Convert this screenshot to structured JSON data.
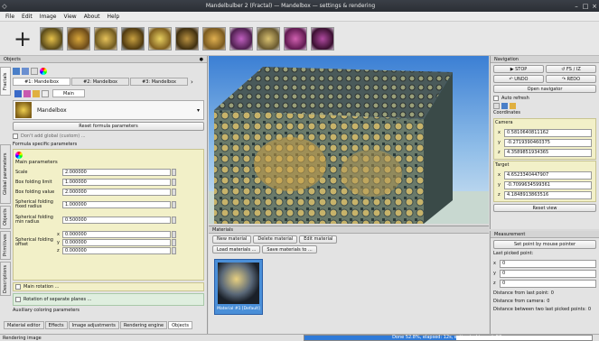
{
  "window": {
    "title": "Mandelbulber 2 (Fractal) — Mandelbox  — settings & rendering",
    "min": "–",
    "max": "□",
    "close": "×"
  },
  "menu": [
    "File",
    "Edit",
    "Image",
    "View",
    "About",
    "Help"
  ],
  "toolbar": {
    "add_icon": "+"
  },
  "objects_panel": {
    "title": "Objects",
    "tabs": [
      "Fractals",
      "Global parameters",
      "Objects",
      "Primitives",
      "Descriptions"
    ],
    "formula_tabs": [
      "#1: Mandelbox",
      "#2: Mandelbox",
      "#3: Mandelbox"
    ],
    "mini_tab": "Main",
    "formula_name": "Mandelbox",
    "reset_button": "Reset formula parameters",
    "check_label": "Don't add global (custom) ...",
    "section_label": "Formula specific parameters",
    "group_label": "Main parameters",
    "params": [
      {
        "label": "Scale",
        "value": "2.000000"
      },
      {
        "label": "Box folding limit",
        "value": "1.000000"
      },
      {
        "label": "Box folding value",
        "value": "2.000000"
      },
      {
        "label": "Spherical folding fixed radius",
        "value": "1.000000"
      },
      {
        "label": "Spherical folding min radius",
        "value": "0.500000"
      }
    ],
    "sph_offset_label": "Spherical folding offset",
    "sph_offset": {
      "x": "0.000000",
      "y": "0.000000",
      "z": "0.000000"
    },
    "main_rotation": "Main rotation ...",
    "rotation_sep": "Rotation of separate planes ...",
    "color_params": "Auxiliary coloring parameters",
    "bottom_tabs": [
      "Material editor",
      "Effects",
      "Image adjustments",
      "Rendering engine",
      "Objects"
    ]
  },
  "viewport": {
    "materials_title": "Materials",
    "buttons": [
      "New material",
      "Delete material",
      "Edit material"
    ],
    "load_button": "Load materials ...",
    "save_button": "Save materials to ...",
    "material_label": "Material #1 [Default]"
  },
  "navigation": {
    "title": "Navigation",
    "move_buttons": [
      "▶ STOP",
      "↺ FS / IZ",
      "↶ UNDO",
      "↷ REDO"
    ],
    "open_nav": "Open navigator",
    "auto_label": "Auto refresh",
    "coords_label": "Coordinates",
    "camera_label": "Camera",
    "camera": {
      "x": "0.5810640811162",
      "y": "-0.2719390460375",
      "z": "4.3589851934365"
    },
    "target_label": "Target",
    "target": {
      "x": "4.6523340447907",
      "y": "-0.7099634599361",
      "z": "4.1848913863516"
    },
    "reset_view": "Reset view"
  },
  "measurement": {
    "title": "Measurement",
    "button": "Set point by mouse pointer",
    "last_point": "Last picked point:",
    "x": "0",
    "y": "0",
    "z": "0",
    "dist_last": "Distance from last point:",
    "dist_last_val": "0",
    "dist_camera": "Distance from camera:",
    "dist_camera_val": "0",
    "between": "Distance between two last picked points:",
    "between_val": "0"
  },
  "status": {
    "left": "Rendering image",
    "progress_text": "Done 52.8%, elapsed: 12s, estimated to end: 52s",
    "progress": 0.528
  },
  "colors": {
    "accent": "#3b7fd4",
    "formula_bg": "#f2f0c8",
    "selected": "#4a8fd8"
  }
}
